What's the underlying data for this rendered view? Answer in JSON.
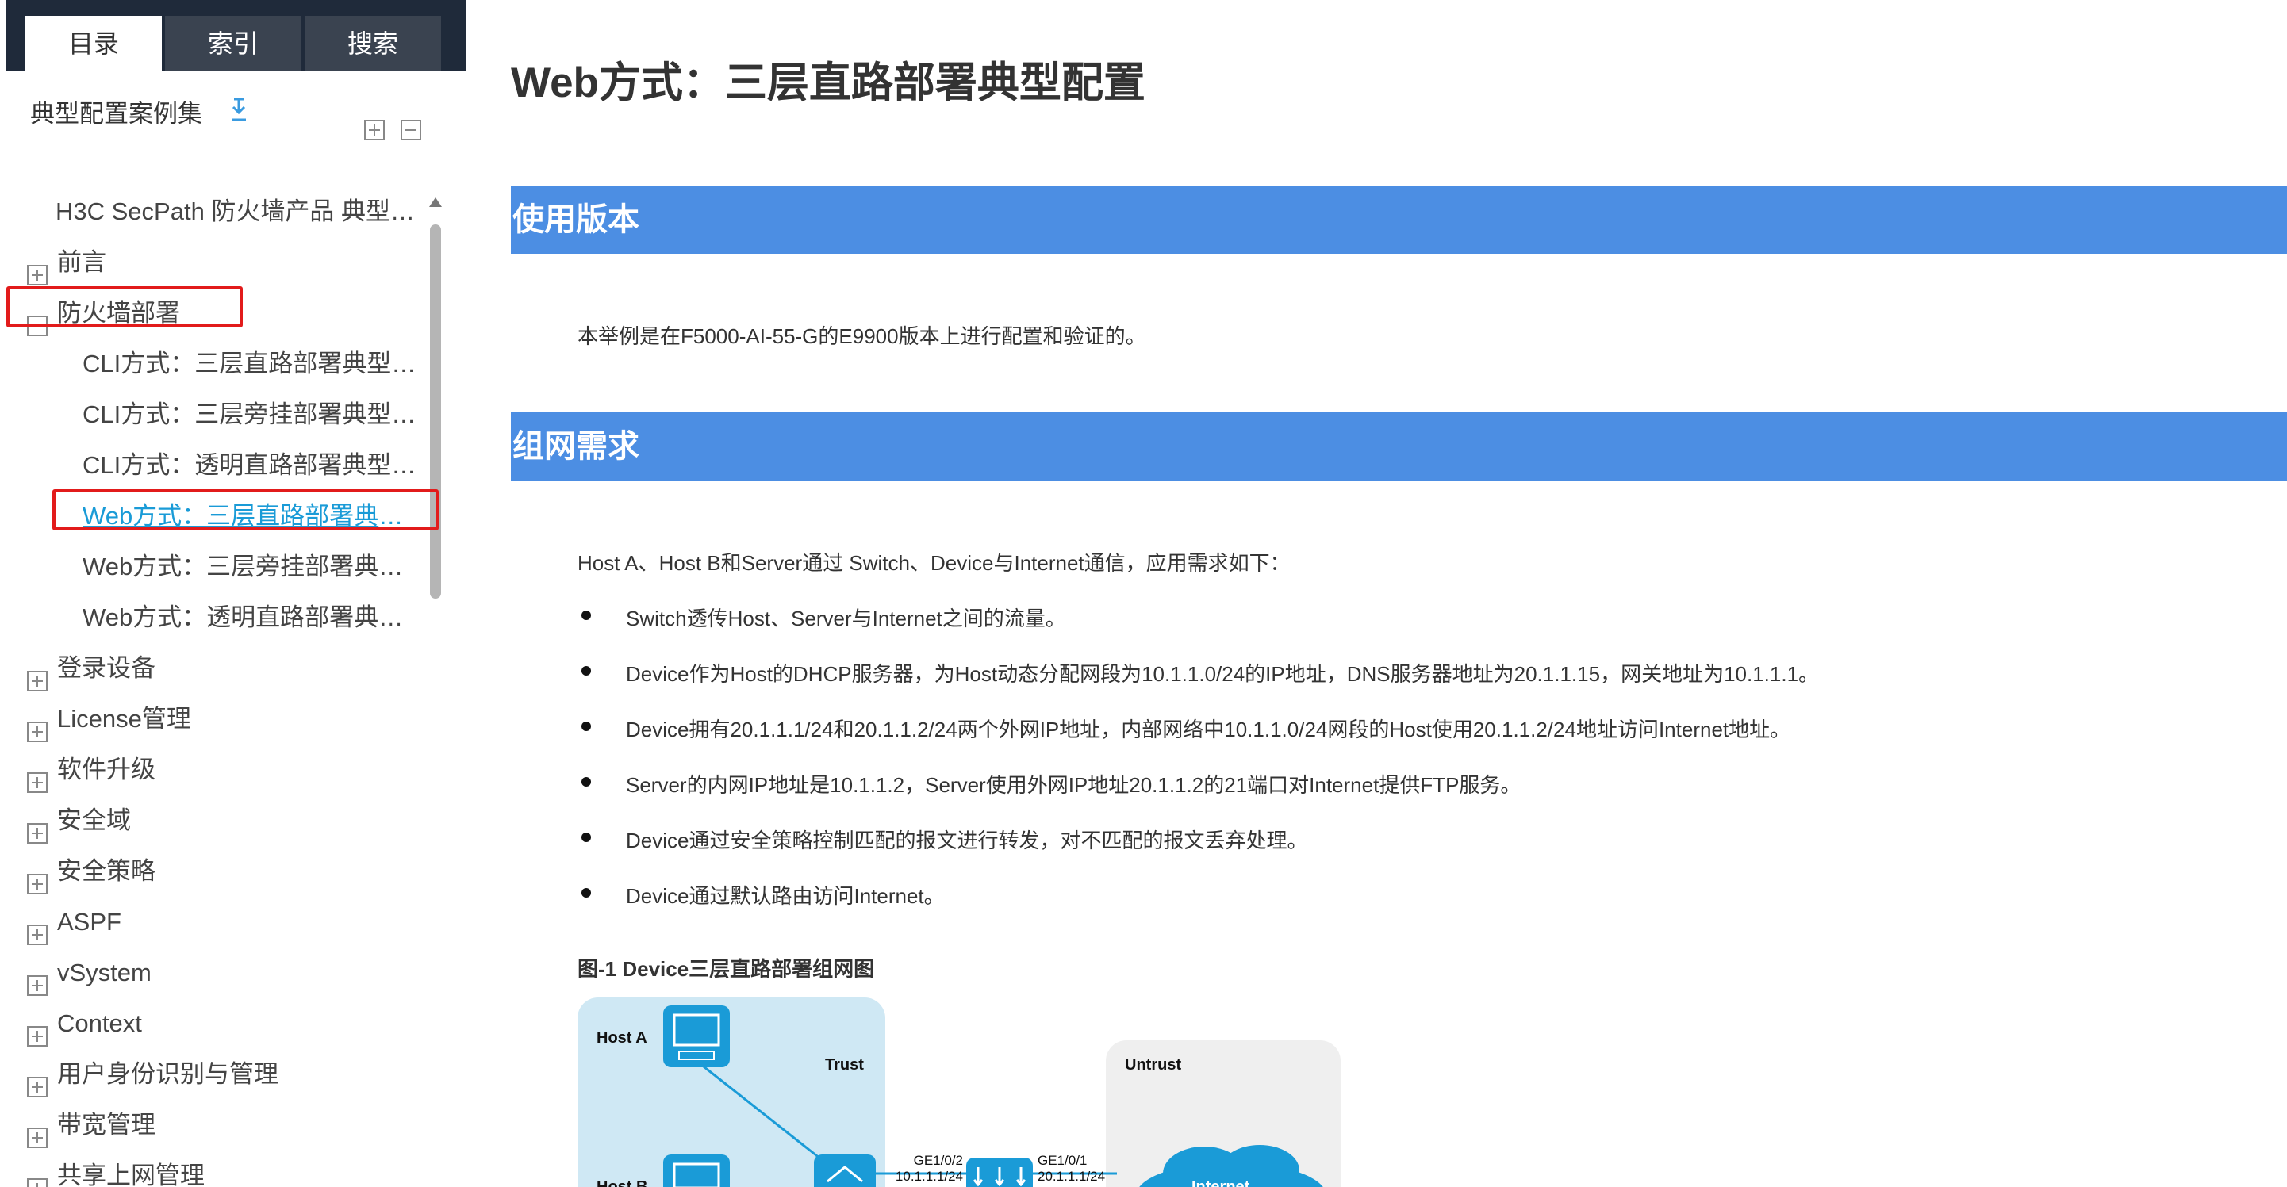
{
  "sidebar": {
    "tabs": [
      {
        "label": "目录",
        "active": true
      },
      {
        "label": "索引",
        "active": false
      },
      {
        "label": "搜索",
        "active": false
      }
    ],
    "book_title": "典型配置案例集",
    "tree": [
      {
        "label": "H3C SecPath 防火墙产品 典型配...",
        "level": 0,
        "toggle": "none"
      },
      {
        "label": "前言",
        "level": 0,
        "toggle": "plus"
      },
      {
        "label": "防火墙部署",
        "level": 0,
        "toggle": "minus"
      },
      {
        "label": "CLI方式：三层直路部署典型配...",
        "level": 1,
        "toggle": "none"
      },
      {
        "label": "CLI方式：三层旁挂部署典型配...",
        "level": 1,
        "toggle": "none"
      },
      {
        "label": "CLI方式：透明直路部署典型配...",
        "level": 1,
        "toggle": "none"
      },
      {
        "label": "Web方式：三层直路部署典型...",
        "level": 1,
        "toggle": "none",
        "current": true
      },
      {
        "label": "Web方式：三层旁挂部署典型...",
        "level": 1,
        "toggle": "none"
      },
      {
        "label": "Web方式：透明直路部署典型...",
        "level": 1,
        "toggle": "none"
      },
      {
        "label": "登录设备",
        "level": 0,
        "toggle": "plus"
      },
      {
        "label": "License管理",
        "level": 0,
        "toggle": "plus"
      },
      {
        "label": "软件升级",
        "level": 0,
        "toggle": "plus"
      },
      {
        "label": "安全域",
        "level": 0,
        "toggle": "plus"
      },
      {
        "label": "安全策略",
        "level": 0,
        "toggle": "plus"
      },
      {
        "label": "ASPF",
        "level": 0,
        "toggle": "plus"
      },
      {
        "label": "vSystem",
        "level": 0,
        "toggle": "plus"
      },
      {
        "label": "Context",
        "level": 0,
        "toggle": "plus"
      },
      {
        "label": "用户身份识别与管理",
        "level": 0,
        "toggle": "plus"
      },
      {
        "label": "带宽管理",
        "level": 0,
        "toggle": "plus"
      },
      {
        "label": "共享上网管理",
        "level": 0,
        "toggle": "plus"
      }
    ],
    "icons": {
      "download": "download-icon",
      "expand_all": "expand-all-icon",
      "collapse_all": "collapse-all-icon"
    }
  },
  "main": {
    "title": "Web方式：三层直路部署典型配置",
    "section1": {
      "heading": "使用版本",
      "text": "本举例是在F5000-AI-55-G的E9900版本上进行配置和验证的。"
    },
    "section2": {
      "heading": "组网需求",
      "intro": "Host A、Host B和Server通过 Switch、Device与Internet通信，应用需求如下：",
      "bullets": [
        "Switch透传Host、Server与Internet之间的流量。",
        "Device作为Host的DHCP服务器，为Host动态分配网段为10.1.1.0/24的IP地址，DNS服务器地址为20.1.1.15，网关地址为10.1.1.1。",
        "Device拥有20.1.1.1/24和20.1.1.2/24两个外网IP地址，内部网络中10.1.1.0/24网段的Host使用20.1.1.2/24地址访问Internet地址。",
        "Server的内网IP地址是10.1.1.2，Server使用外网IP地址20.1.1.2的21端口对Internet提供FTP服务。",
        "Device通过安全策略控制匹配的报文进行转发，对不匹配的报文丢弃处理。",
        "Device通过默认路由访问Internet。"
      ],
      "figure_caption": "图-1 Device三层直路部署组网图",
      "diagram": {
        "host_a": "Host A",
        "host_b": "Host B",
        "trust": "Trust",
        "untrust": "Untrust",
        "internet": "Internet",
        "if_in_name": "GE1/0/2",
        "if_in_ip": "10.1.1.1/24",
        "if_out_name": "GE1/0/1",
        "if_out_ip": "20.1.1.1/24"
      }
    }
  },
  "colors": {
    "section_bar": "#4c8ee3",
    "tab_dark": "#1f2a3a",
    "current_link": "#1a9bd7",
    "highlight": "#e21b1b"
  }
}
